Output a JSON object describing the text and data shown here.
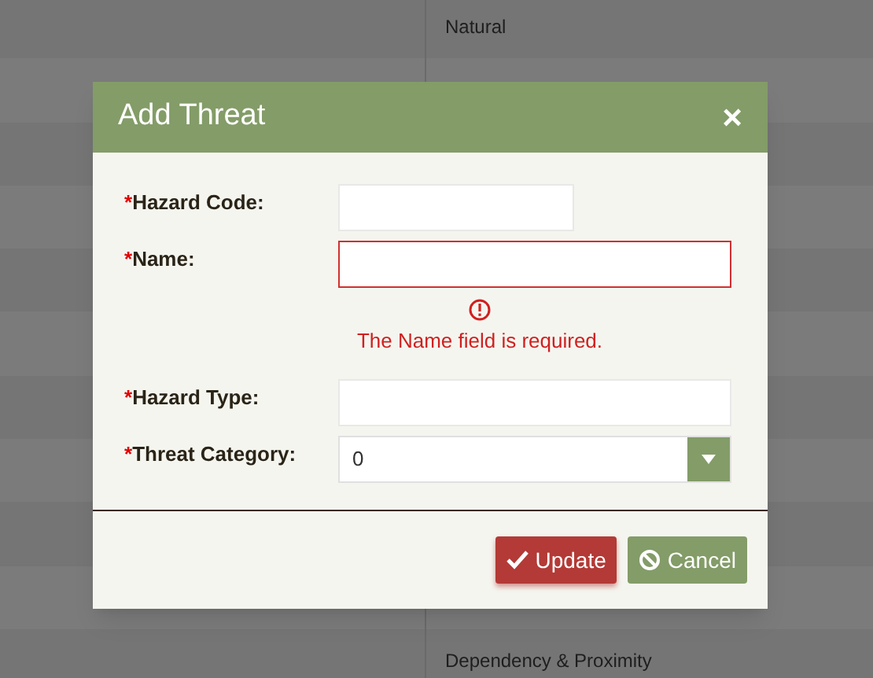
{
  "background_table": {
    "rows": [
      {
        "column_2": "Natural"
      },
      {},
      {},
      {},
      {},
      {},
      {},
      {},
      {},
      {},
      {
        "column_2": "Dependency & Proximity"
      }
    ]
  },
  "dialog": {
    "title": "Add Threat",
    "close": "×",
    "fields": [
      {
        "label": "Hazard Code:",
        "required_mark": "*",
        "kind": "short",
        "invalid": false
      },
      {
        "label": "Name:",
        "required_mark": "*",
        "kind": "text",
        "invalid": true,
        "error": "The Name field is required."
      },
      {
        "label": "Hazard Type:",
        "required_mark": "*",
        "kind": "text",
        "invalid": false
      },
      {
        "label": "Threat Category:",
        "required_mark": "*",
        "kind": "select",
        "value": "0",
        "invalid": false
      }
    ],
    "buttons": [
      {
        "label": "Update",
        "kind": "primary"
      },
      {
        "label": "Cancel",
        "kind": "secondary"
      }
    ]
  }
}
